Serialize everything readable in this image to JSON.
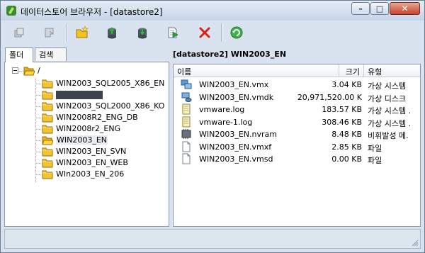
{
  "window": {
    "title": "데이터스토어 브라우저 - [datastore2]"
  },
  "window_buttons": {
    "minimize": "–",
    "maximize": "□",
    "close": "✕"
  },
  "toolbar": {
    "buttons": [
      {
        "name": "upload-icon",
        "color": "#9aa3ae"
      },
      {
        "name": "download-icon",
        "color": "#9aa3ae"
      },
      {
        "name": "new-folder-icon",
        "color": "#e5b100"
      },
      {
        "name": "upload-to-datastore-icon",
        "color": "#3c8d3c"
      },
      {
        "name": "download-from-datastore-icon",
        "color": "#3c8d3c"
      },
      {
        "name": "register-vm-icon",
        "color": "#3c8d3c"
      },
      {
        "name": "delete-icon",
        "color": "#e02010"
      },
      {
        "name": "refresh-icon",
        "color": "#2a9a2a"
      }
    ]
  },
  "tabs": {
    "folders": "폴더",
    "search": "검색"
  },
  "tree": {
    "root": "/",
    "items": [
      "WIN2003_SQL2005_X86_EN",
      "",
      "WIN2003_SQL2000_X86_KO",
      "WIN2008R2_ENG_DB",
      "WIN2008r2_ENG",
      "WIN2003_EN",
      "WIN2003_EN_SVN",
      "WIN2003_EN_WEB",
      "WIn2003_EN_206"
    ],
    "selected_index": 5
  },
  "path_header": "[datastore2] WIN2003_EN",
  "file_list": {
    "columns": {
      "name": "이름",
      "size": "크기",
      "type": "유형"
    },
    "rows": [
      {
        "name": "WIN2003_EN.vmx",
        "size": "3.04 KB",
        "type": "가상 시스템",
        "icon": "vm-config-icon"
      },
      {
        "name": "WIN2003_EN.vmdk",
        "size": "20,971,520.00 K",
        "type": "가상 디스크",
        "icon": "virtual-disk-icon"
      },
      {
        "name": "vmware.log",
        "size": "183.57 KB",
        "type": "가상 시스템 .",
        "icon": "log-file-icon"
      },
      {
        "name": "vmware-1.log",
        "size": "308.46 KB",
        "type": "가상 시스템 .",
        "icon": "log-file-icon"
      },
      {
        "name": "WIN2003_EN.nvram",
        "size": "8.48 KB",
        "type": "비휘발성 메.",
        "icon": "nvram-icon"
      },
      {
        "name": "WIN2003_EN.vmxf",
        "size": "2.85 KB",
        "type": "파일",
        "icon": "file-icon"
      },
      {
        "name": "WIN2003_EN.vmsd",
        "size": "0.00 KB",
        "type": "파일",
        "icon": "file-icon"
      }
    ]
  }
}
